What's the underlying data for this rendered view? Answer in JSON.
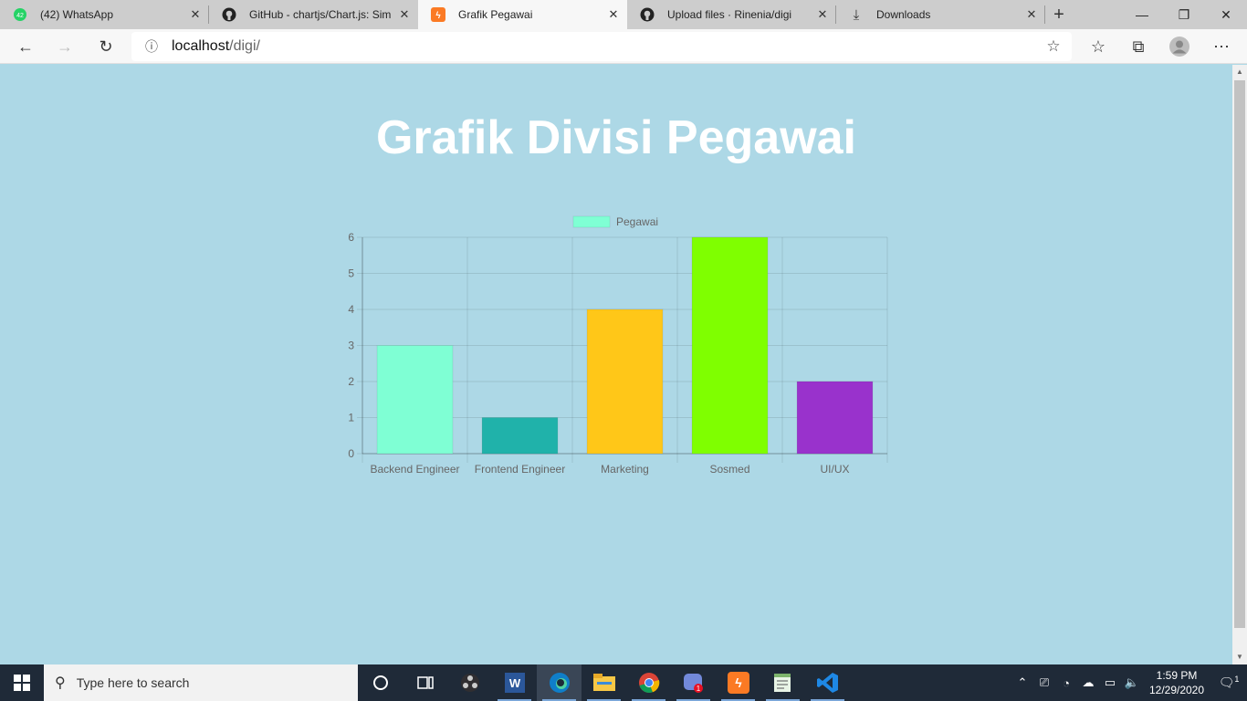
{
  "browser": {
    "tabs": [
      {
        "title": "(42) WhatsApp",
        "icon": "whatsapp-icon",
        "badge": "42"
      },
      {
        "title": "GitHub - chartjs/Chart.js: Simp",
        "icon": "github-icon"
      },
      {
        "title": "Grafik Pegawai",
        "icon": "xampp-icon",
        "active": true
      },
      {
        "title": "Upload files · Rinenia/digi",
        "icon": "github-icon"
      },
      {
        "title": "Downloads",
        "icon": "download-icon"
      }
    ],
    "address": {
      "host": "localhost",
      "path": "/digi/"
    }
  },
  "page": {
    "title": "Grafik Divisi Pegawai"
  },
  "chart_data": {
    "type": "bar",
    "categories": [
      "Backend Engineer",
      "Frontend Engineer",
      "Marketing",
      "Sosmed",
      "UI/UX"
    ],
    "series": [
      {
        "name": "Pegawai",
        "values": [
          3,
          1,
          4,
          6,
          2
        ]
      }
    ],
    "bar_colors": [
      "#7fffd4",
      "#20b2aa",
      "#ffc718",
      "#7fff00",
      "#9932cc"
    ],
    "legend_color": "#7fffd4",
    "ylim": [
      0,
      6
    ],
    "yticks": [
      "0",
      "1",
      "2",
      "3",
      "4",
      "5",
      "6"
    ],
    "legend": "top",
    "grid": true
  },
  "taskbar": {
    "search_placeholder": "Type here to search",
    "time": "1:59 PM",
    "date": "12/29/2020",
    "notification_count": "1",
    "apps": [
      "task-view-icon",
      "obs-icon",
      "word-icon",
      "edge-icon",
      "file-explorer-icon",
      "chrome-icon",
      "discord-icon",
      "xampp-icon",
      "notepad-icon",
      "vscode-icon"
    ]
  }
}
